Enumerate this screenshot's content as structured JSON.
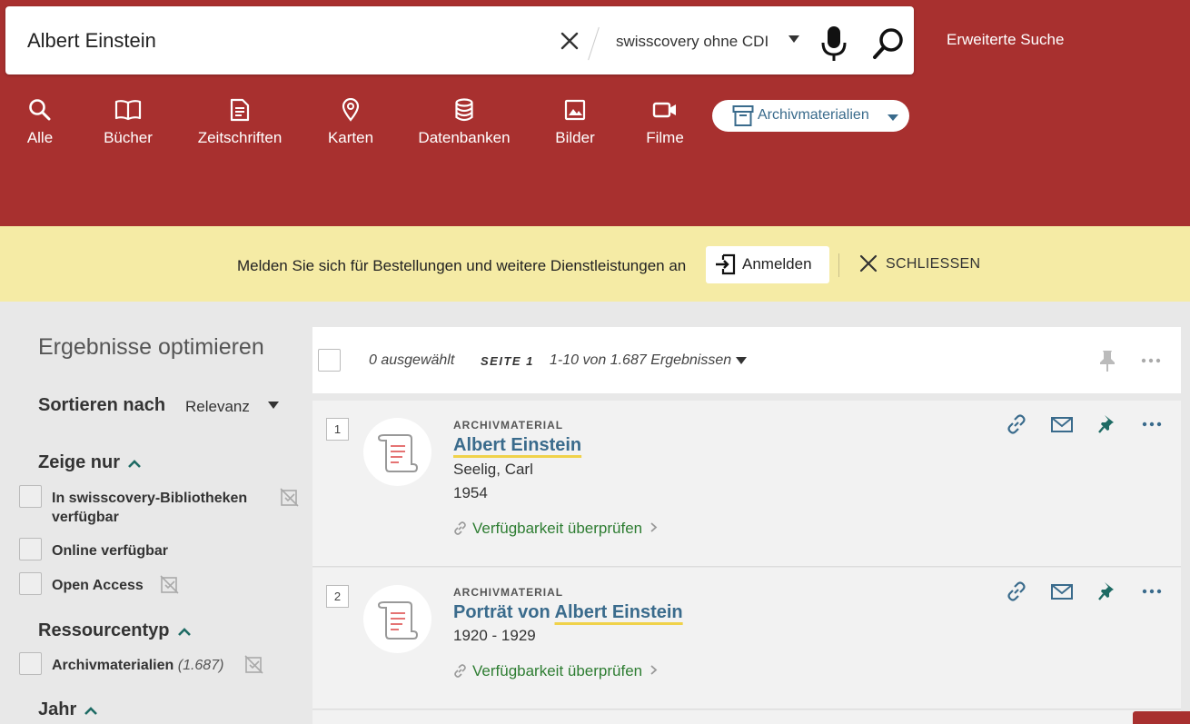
{
  "search": {
    "query": "Albert Einstein",
    "scope": "swisscovery ohne CDI",
    "advanced_label": "Erweiterte Suche"
  },
  "categories": [
    {
      "label": "Alle",
      "icon": "search-icon"
    },
    {
      "label": "Bücher",
      "icon": "book-icon"
    },
    {
      "label": "Zeitschriften",
      "icon": "journal-icon"
    },
    {
      "label": "Karten",
      "icon": "map-pin-icon"
    },
    {
      "label": "Datenbanken",
      "icon": "database-icon"
    },
    {
      "label": "Bilder",
      "icon": "image-icon"
    },
    {
      "label": "Filme",
      "icon": "video-icon"
    }
  ],
  "archive_dropdown": {
    "label": "Archivmaterialien",
    "icon": "archive-box-icon"
  },
  "banner": {
    "text": "Melden Sie sich für Bestellungen und weitere Dienstleistungen an",
    "login_label": "Anmelden",
    "close_label": "SCHLIESSEN"
  },
  "sidebar": {
    "title": "Ergebnisse optimieren",
    "sort_label": "Sortieren nach",
    "sort_value": "Relevanz",
    "show_only_title": "Zeige nur",
    "show_only": [
      {
        "line1": "In swisscovery-Bibliotheken",
        "line2": "verfügbar"
      },
      {
        "line1": "Online verfügbar"
      },
      {
        "line1": "Open Access"
      }
    ],
    "resource_type_title": "Ressourcentyp",
    "resource_types": [
      {
        "label": "Archivmaterialien",
        "count": "(1.687)"
      }
    ],
    "year_title": "Jahr"
  },
  "toolbar": {
    "selected": "0 ausgewählt",
    "page": "SEITE 1",
    "range": "1-10 von 1.687 Ergebnissen"
  },
  "results": [
    {
      "number": "1",
      "type": "ARCHIVMATERIAL",
      "title_prefix": "",
      "title_highlight": "Albert Einstein",
      "author": "Seelig, Carl",
      "date": "1954",
      "availability": "Verfügbarkeit überprüfen"
    },
    {
      "number": "2",
      "type": "ARCHIVMATERIAL",
      "title_prefix": "Porträt von ",
      "title_highlight": "Albert Einstein",
      "date": "1920 - 1929",
      "availability": "Verfügbarkeit überprüfen"
    }
  ],
  "colors": {
    "header_bg": "#a8302f",
    "banner_bg": "#f5eba5",
    "link": "#3a6b8c",
    "available": "#2e7d32",
    "pin": "#1e6b64",
    "highlight": "#f0d24a"
  }
}
